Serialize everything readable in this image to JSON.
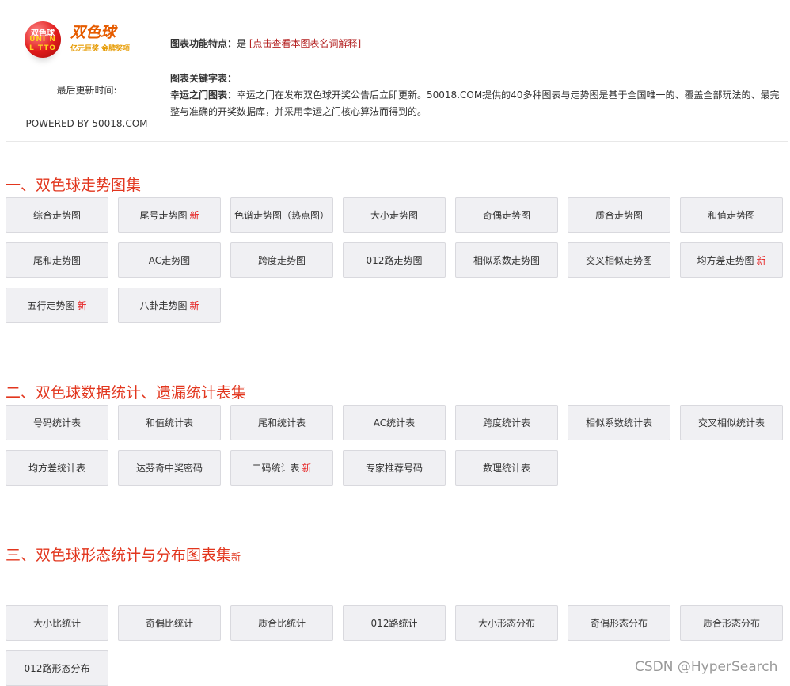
{
  "header": {
    "logo": {
      "badge_top": "双色球",
      "badge_mid": "UNI N",
      "badge_bot": "L TTO",
      "title": "双色球",
      "slogan": "亿元巨奖  金牌奖项"
    },
    "updated_label": "最后更新时间:",
    "powered_by": "POWERED BY 50018.COM",
    "features_label": "图表功能特点：",
    "features_value": "是",
    "features_link": "[点击查看本图表名词解释]",
    "keywords_title": "图表关键字表：",
    "keywords_prefix": "幸运之门图表：",
    "keywords_text": "幸运之门在发布双色球开奖公告后立即更新。50018.COM提供的40多种图表与走势图是基于全国唯一的、覆盖全部玩法的、最完整与准确的开奖数据库，并采用幸运之门核心算法而得到的。"
  },
  "sections": [
    {
      "title": "一、双色球走势图集",
      "new_tag": "",
      "items": [
        {
          "label": "综合走势图",
          "new": ""
        },
        {
          "label": "尾号走势图",
          "new": "新"
        },
        {
          "label": "色谱走势图（热点图）",
          "new": ""
        },
        {
          "label": "大小走势图",
          "new": ""
        },
        {
          "label": "奇偶走势图",
          "new": ""
        },
        {
          "label": "质合走势图",
          "new": ""
        },
        {
          "label": "和值走势图",
          "new": ""
        },
        {
          "label": "尾和走势图",
          "new": ""
        },
        {
          "label": "AC走势图",
          "new": ""
        },
        {
          "label": "跨度走势图",
          "new": ""
        },
        {
          "label": "012路走势图",
          "new": ""
        },
        {
          "label": "相似系数走势图",
          "new": ""
        },
        {
          "label": "交叉相似走势图",
          "new": ""
        },
        {
          "label": "均方差走势图",
          "new": "新"
        },
        {
          "label": "五行走势图",
          "new": "新"
        },
        {
          "label": "八卦走势图",
          "new": "新"
        }
      ]
    },
    {
      "title": "二、双色球数据统计、遗漏统计表集",
      "new_tag": "",
      "items": [
        {
          "label": "号码统计表",
          "new": ""
        },
        {
          "label": "和值统计表",
          "new": ""
        },
        {
          "label": "尾和统计表",
          "new": ""
        },
        {
          "label": "AC统计表",
          "new": ""
        },
        {
          "label": "跨度统计表",
          "new": ""
        },
        {
          "label": "相似系数统计表",
          "new": ""
        },
        {
          "label": "交叉相似统计表",
          "new": ""
        },
        {
          "label": "均方差统计表",
          "new": ""
        },
        {
          "label": "达芬奇中奖密码",
          "new": ""
        },
        {
          "label": "二码统计表",
          "new": "新"
        },
        {
          "label": "专家推荐号码",
          "new": ""
        },
        {
          "label": "数理统计表",
          "new": ""
        }
      ]
    },
    {
      "title": "三、双色球形态统计与分布图表集",
      "new_tag": "新",
      "items": [
        {
          "label": "大小比统计",
          "new": ""
        },
        {
          "label": "奇偶比统计",
          "new": ""
        },
        {
          "label": "质合比统计",
          "new": ""
        },
        {
          "label": "012路统计",
          "new": ""
        },
        {
          "label": "大小形态分布",
          "new": ""
        },
        {
          "label": "奇偶形态分布",
          "new": ""
        },
        {
          "label": "质合形态分布",
          "new": ""
        },
        {
          "label": "012路形态分布",
          "new": ""
        }
      ]
    }
  ],
  "watermark": "CSDN @HyperSearch"
}
